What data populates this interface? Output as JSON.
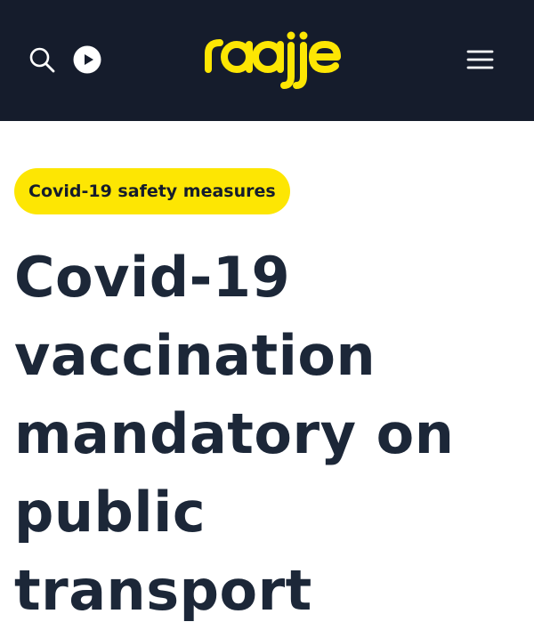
{
  "header": {
    "logo_text": "raajje",
    "icons": {
      "search": "search-icon",
      "play": "play-icon",
      "menu": "hamburger-menu-icon"
    },
    "colors": {
      "background": "#151c2c",
      "logo": "#fde603",
      "icons": "#ffffff"
    }
  },
  "article": {
    "category_badge": "Covid-19 safety measures",
    "headline": "Covid-19 vaccination mandatory on public transport",
    "colors": {
      "badge_background": "#fde603",
      "headline": "#1c2738"
    }
  }
}
